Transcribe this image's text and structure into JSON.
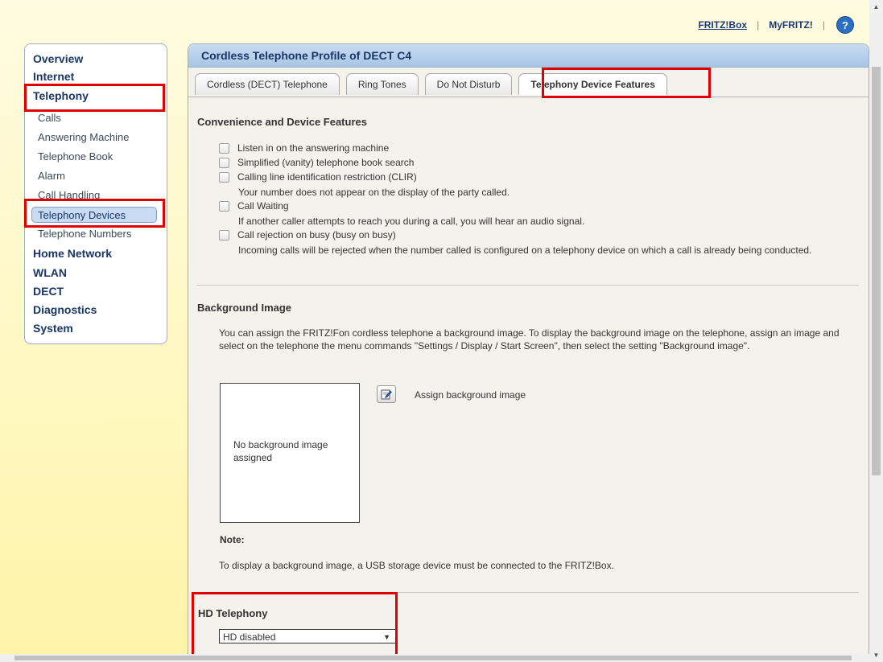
{
  "top_links": {
    "fritzbox": "FRITZ!Box",
    "separator": "|",
    "myfritz": "MyFRITZ!",
    "help": "?"
  },
  "sidebar": {
    "overview": "Overview",
    "internet": "Internet",
    "telephony": "Telephony",
    "sub": {
      "calls": "Calls",
      "answering_machine": "Answering Machine",
      "telephone_book": "Telephone Book",
      "alarm": "Alarm",
      "call_handling": "Call Handling",
      "telephony_devices": "Telephony Devices",
      "telephone_numbers": "Telephone Numbers"
    },
    "home_network": "Home Network",
    "wlan": "WLAN",
    "dect": "DECT",
    "diagnostics": "Diagnostics",
    "system": "System"
  },
  "panel": {
    "title": "Cordless Telephone Profile of DECT C4",
    "tabs": {
      "cordless": "Cordless (DECT) Telephone",
      "ring_tones": "Ring Tones",
      "do_not_disturb": "Do Not Disturb",
      "device_features": "Telephony Device Features"
    }
  },
  "convenience": {
    "title": "Convenience and Device Features",
    "listen_in": "Listen in on the answering machine",
    "vanity_search": "Simplified (vanity) telephone book search",
    "clir": "Calling line identification restriction (CLIR)",
    "clir_desc": "Your number does not appear on the display of the party called.",
    "call_waiting": "Call Waiting",
    "call_waiting_desc": "If another caller attempts to reach you during a call, you will hear an audio signal.",
    "busy_on_busy": "Call rejection on busy (busy on busy)",
    "busy_on_busy_desc": "Incoming calls will be rejected when the number called is configured on a telephony device on which a call is already being conducted."
  },
  "background": {
    "title": "Background Image",
    "description": "You can assign the FRITZ!Fon cordless telephone a background image. To display the background image on the telephone, assign an image and select on the telephone the menu commands \"Settings / Display / Start Screen\", then select the setting \"Background image\".",
    "no_image": "No background image assigned",
    "assign_label": "Assign background image",
    "note_title": "Note:",
    "note_text": "To display a background image, a USB storage device must be connected to the FRITZ!Box."
  },
  "hd": {
    "title": "HD Telephony",
    "selected": "HD disabled"
  },
  "colors": {
    "highlight": "#e00000",
    "nav": "#1a3766",
    "panel_header": "#b8d0ec"
  }
}
